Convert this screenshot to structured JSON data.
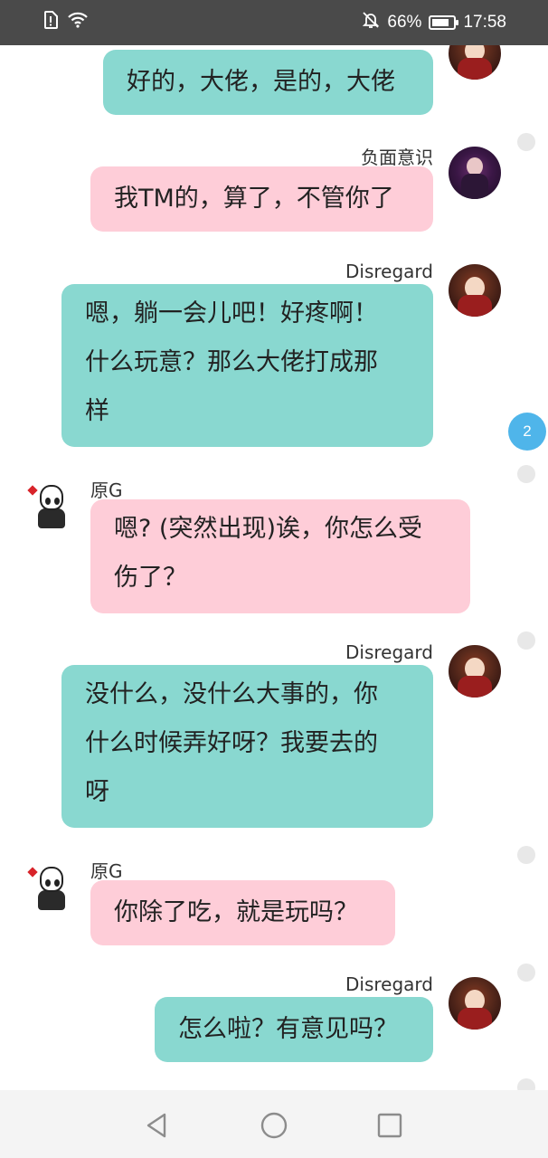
{
  "status_bar": {
    "battery_percent": "66%",
    "battery_level": 0.66,
    "time": "17:58",
    "icons": [
      "sim-alert-icon",
      "wifi-icon",
      "mute-bell-icon",
      "battery-icon"
    ]
  },
  "messages": [
    {
      "sender": "",
      "text": "好的，大佬，是的，大佬",
      "side": "right",
      "color": "#89d8d0"
    },
    {
      "sender": "负面意识",
      "text": "我TM的，算了，不管你了",
      "side": "right",
      "color": "#fecdd8"
    },
    {
      "sender": "Disregard",
      "lines": [
        "嗯，躺一会儿吧！好疼啊！",
        "什么玩意？那么大佬打成那",
        "样"
      ],
      "side": "right",
      "color": "#89d8d0"
    },
    {
      "sender": "原G",
      "lines": [
        "嗯? (突然出现)诶，你怎么受",
        "伤了？"
      ],
      "side": "left",
      "color": "#fecdd8"
    },
    {
      "sender": "Disregard",
      "lines": [
        "没什么，没什么大事的，你",
        "什么时候弄好呀？我要去的",
        "呀"
      ],
      "side": "right",
      "color": "#89d8d0"
    },
    {
      "sender": "原G",
      "text": "你除了吃，就是玩吗？",
      "side": "left",
      "color": "#fecdd8"
    },
    {
      "sender": "Disregard",
      "text": "怎么啦？有意见吗？",
      "side": "right",
      "color": "#89d8d0"
    }
  ],
  "unread_badge": "2",
  "nav": {
    "back": "back-icon",
    "home": "home-icon",
    "recents": "recents-icon"
  }
}
